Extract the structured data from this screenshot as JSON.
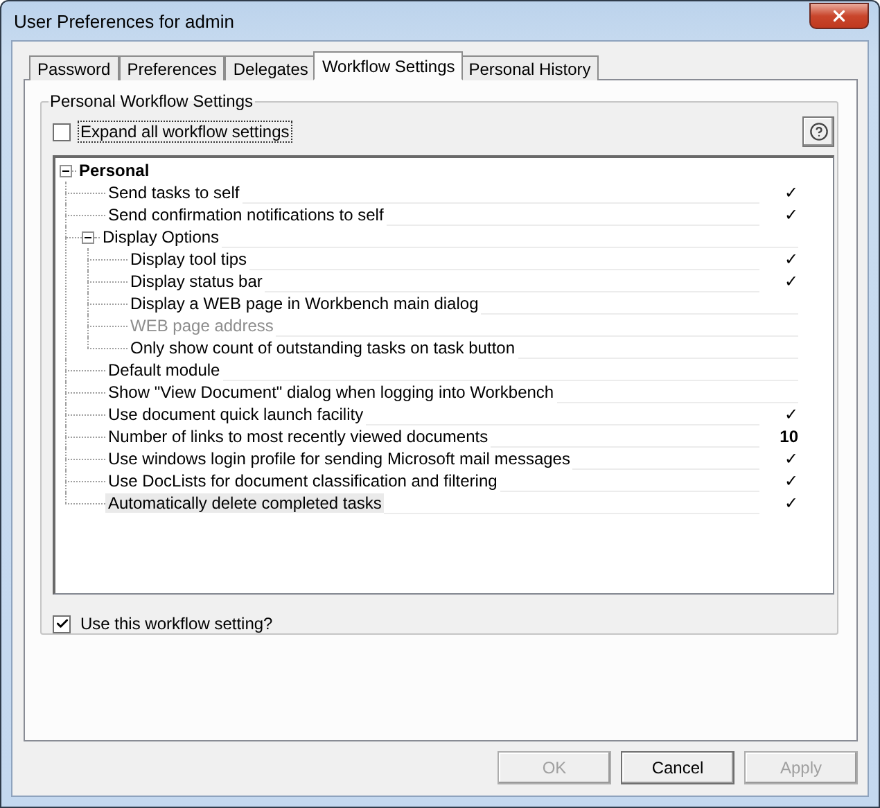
{
  "window": {
    "title": "User Preferences for admin"
  },
  "tabs": [
    {
      "label": "Password",
      "selected": false
    },
    {
      "label": "Preferences",
      "selected": false
    },
    {
      "label": "Delegates",
      "selected": false
    },
    {
      "label": "Workflow Settings",
      "selected": true
    },
    {
      "label": "Personal History",
      "selected": false
    }
  ],
  "group": {
    "title": "Personal Workflow Settings"
  },
  "expand_all": {
    "label": "Expand all workflow settings",
    "checked": false
  },
  "tree": [
    {
      "label": "Personal",
      "expanded": true,
      "selected": false,
      "disabled": false,
      "children": [
        {
          "label": "Send tasks to self",
          "value": "✓",
          "selected": false,
          "disabled": false
        },
        {
          "label": "Send confirmation notifications to self",
          "value": "✓",
          "selected": false,
          "disabled": false
        },
        {
          "label": "Display Options",
          "expanded": true,
          "selected": false,
          "disabled": false,
          "children": [
            {
              "label": "Display tool tips",
              "value": "✓",
              "selected": false,
              "disabled": false
            },
            {
              "label": "Display status bar",
              "value": "✓",
              "selected": false,
              "disabled": false
            },
            {
              "label": "Display a WEB page in Workbench main dialog",
              "selected": false,
              "disabled": false
            },
            {
              "label": "WEB page address",
              "selected": false,
              "disabled": true
            },
            {
              "label": "Only show count of outstanding tasks on task button",
              "selected": false,
              "disabled": false
            }
          ]
        },
        {
          "label": "Default module",
          "selected": false,
          "disabled": false
        },
        {
          "label": "Show \"View Document\" dialog when logging into Workbench",
          "selected": false,
          "disabled": false
        },
        {
          "label": "Use document quick launch facility",
          "value": "✓",
          "selected": false,
          "disabled": false
        },
        {
          "label": "Number of links to most recently viewed documents",
          "value": "10",
          "selected": false,
          "disabled": false
        },
        {
          "label": "Use windows login profile for sending Microsoft mail messages",
          "value": "✓",
          "selected": false,
          "disabled": false
        },
        {
          "label": "Use DocLists for document classification and filtering",
          "value": "✓",
          "selected": false,
          "disabled": false
        },
        {
          "label": "Automatically delete completed tasks",
          "value": "✓",
          "selected": true,
          "disabled": false
        }
      ]
    }
  ],
  "use_setting": {
    "label": "Use this workflow setting?",
    "checked": true
  },
  "buttons": [
    {
      "label": "OK",
      "disabled": true
    },
    {
      "label": "Cancel",
      "disabled": false
    },
    {
      "label": "Apply",
      "disabled": true
    }
  ]
}
